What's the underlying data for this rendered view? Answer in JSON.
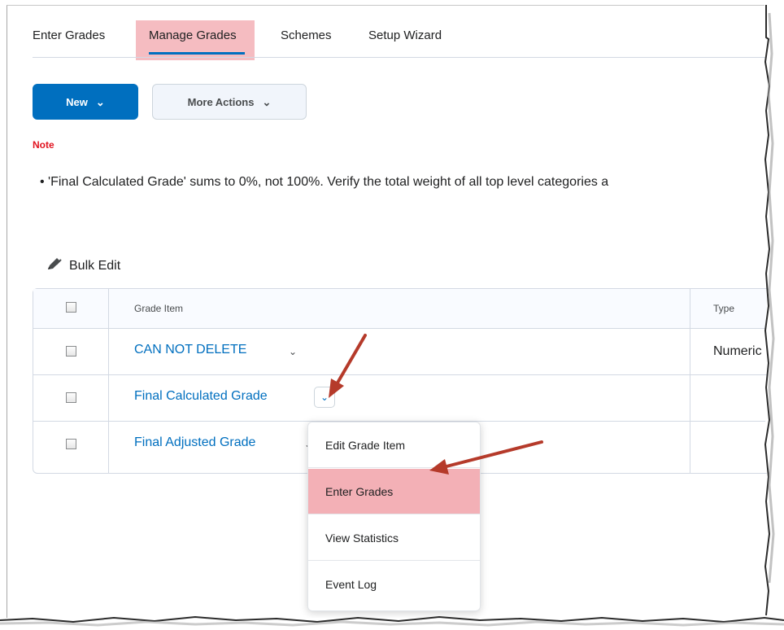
{
  "tabs": [
    {
      "label": "Enter Grades"
    },
    {
      "label": "Manage Grades"
    },
    {
      "label": "Schemes"
    },
    {
      "label": "Setup Wizard"
    }
  ],
  "toolbar": {
    "new_label": "New",
    "more_actions_label": "More Actions"
  },
  "note": {
    "label": "Note",
    "text": "• 'Final Calculated Grade' sums to 0%, not 100%. Verify the total weight of all top level categories a"
  },
  "bulk_edit": {
    "label": "Bulk Edit"
  },
  "table": {
    "headers": {
      "grade_item": "Grade Item",
      "type": "Type"
    },
    "rows": [
      {
        "name": "CAN NOT DELETE",
        "type": "Numeric"
      },
      {
        "name": "Final Calculated Grade",
        "type": ""
      },
      {
        "name": "Final Adjusted Grade",
        "type": ""
      }
    ]
  },
  "context_menu": {
    "items": [
      {
        "label": "Edit Grade Item"
      },
      {
        "label": "Enter Grades"
      },
      {
        "label": "View Statistics"
      },
      {
        "label": "Event Log"
      }
    ]
  },
  "colors": {
    "accent": "#006fbf",
    "highlight": "#f3b0b6",
    "arrow": "#b53a2a",
    "note": "#e1131f"
  }
}
